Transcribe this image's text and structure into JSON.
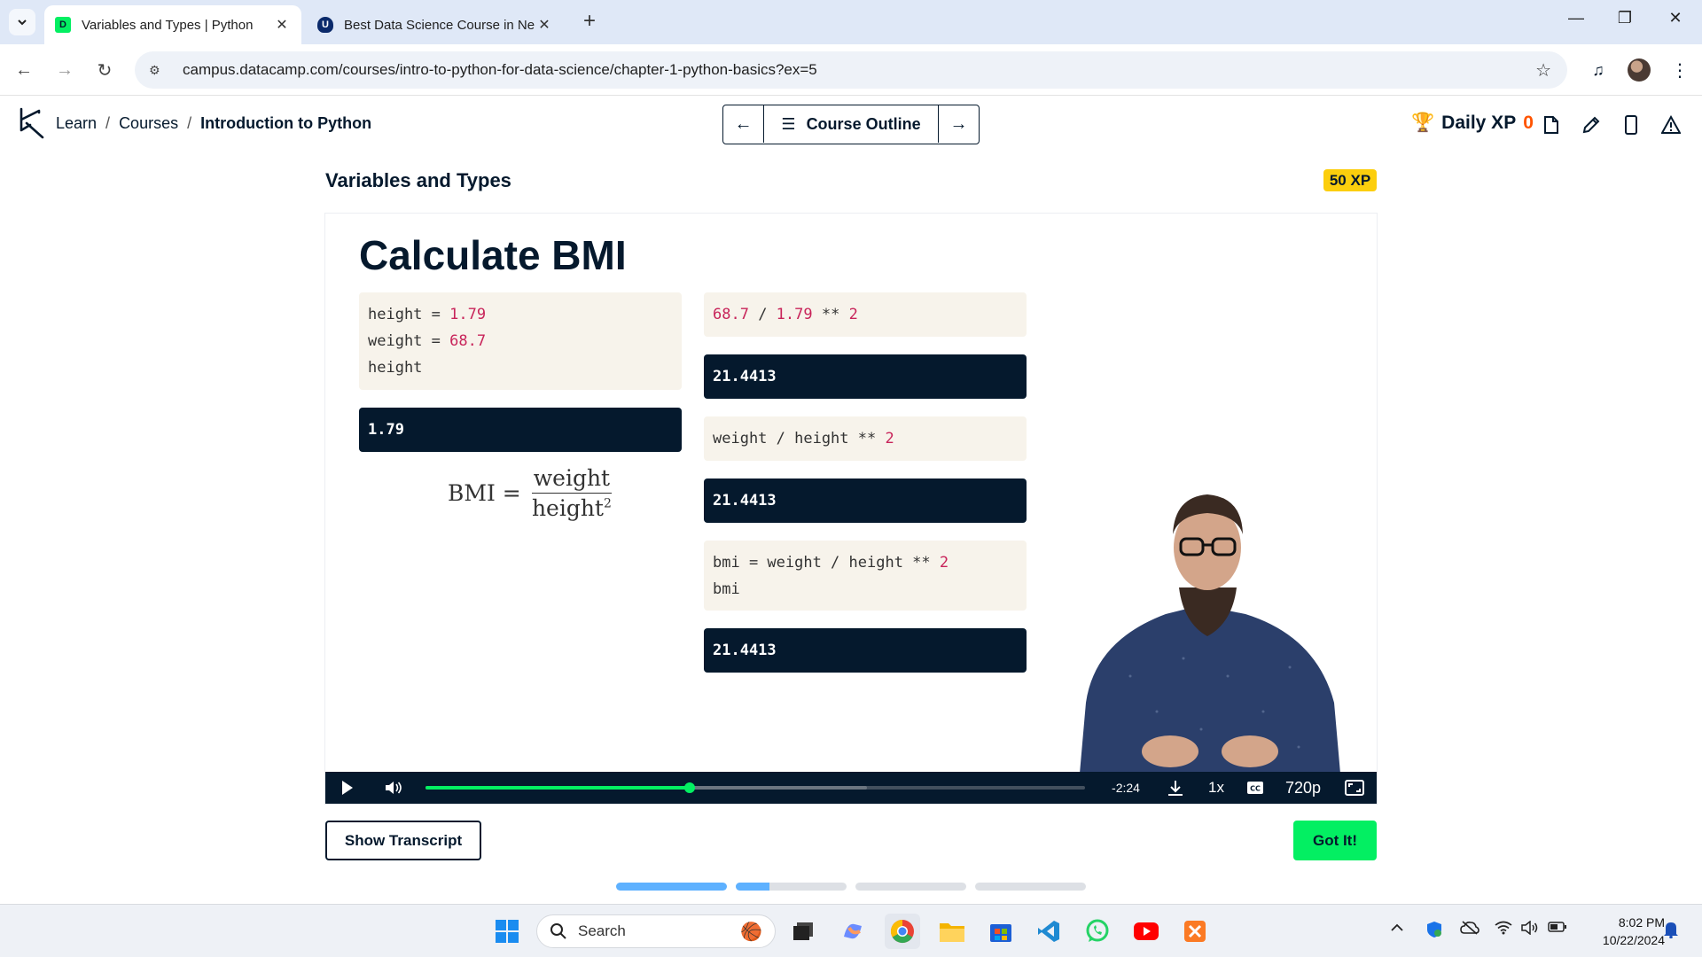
{
  "browser": {
    "tabs": [
      {
        "title": "Variables and Types | Python",
        "active": true,
        "favicon": "datacamp-favicon"
      },
      {
        "title": "Best Data Science Course in Ne",
        "active": false,
        "favicon": "shield-favicon"
      }
    ],
    "url": "campus.datacamp.com/courses/intro-to-python-for-data-science/chapter-1-python-basics?ex=5"
  },
  "header": {
    "breadcrumbs": [
      "Learn",
      "Courses",
      "Introduction to Python"
    ],
    "separator": "/",
    "course_outline_label": "Course Outline",
    "daily_xp_label": "Daily XP",
    "daily_xp_value": "0"
  },
  "lesson": {
    "title": "Variables and Types",
    "xp_badge": "50 XP"
  },
  "slide": {
    "title": "Calculate BMI",
    "left_code": [
      {
        "name": "height",
        "op": " = ",
        "value": "1.79"
      },
      {
        "name": "weight",
        "op": " = ",
        "value": "68.7"
      },
      {
        "name": "height",
        "op": "",
        "value": ""
      }
    ],
    "left_output": "1.79",
    "formula": {
      "lhs": "BMI =",
      "numerator": "weight",
      "denominator": "height",
      "exponent": "2"
    },
    "right_blocks": [
      {
        "code_a": "",
        "num_a": "68.7",
        "code_b": " / ",
        "num_b": "1.79",
        "code_c": " ** ",
        "num_c": "2",
        "output": "21.4413"
      },
      {
        "code_a": "weight / height ** ",
        "num_a": "2",
        "output": "21.4413"
      },
      {
        "line1_a": "bmi = weight / height ** ",
        "line1_num": "2",
        "line2": "bmi",
        "output": "21.4413"
      }
    ]
  },
  "player": {
    "time_remaining": "-2:24",
    "speed": "1x",
    "quality": "720p",
    "progress": 0.4,
    "buffered": 0.67
  },
  "actions": {
    "transcript": "Show Transcript",
    "got_it": "Got It!"
  },
  "pager": [
    1.0,
    0.3,
    0.0,
    0.0
  ],
  "taskbar": {
    "search_placeholder": "Search",
    "time": "8:02 PM",
    "date": "10/22/2024"
  },
  "colors": {
    "brand_green": "#03ef62",
    "navy": "#05192d",
    "xp_yellow": "#fcce0d",
    "number_red": "#c8245a"
  }
}
